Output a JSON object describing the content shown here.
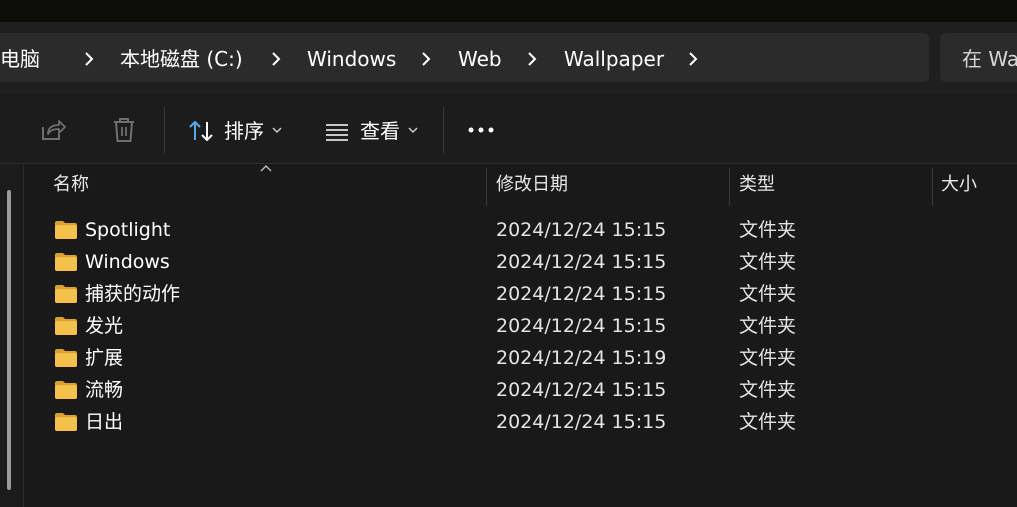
{
  "breadcrumb": {
    "items": [
      "此电脑",
      "本地磁盘 (C:)",
      "Windows",
      "Web",
      "Wallpaper"
    ]
  },
  "search": {
    "placeholder": "在 Wa"
  },
  "toolbar": {
    "share_icon": "share-icon",
    "delete_icon": "trash-icon",
    "sort_label": "排序",
    "view_label": "查看",
    "more_icon": "more-icon"
  },
  "columns": {
    "name": "名称",
    "modified": "修改日期",
    "type": "类型",
    "size": "大小"
  },
  "files": [
    {
      "name": "Spotlight",
      "modified": "2024/12/24 15:15",
      "type": "文件夹"
    },
    {
      "name": "Windows",
      "modified": "2024/12/24 15:15",
      "type": "文件夹"
    },
    {
      "name": "捕获的动作",
      "modified": "2024/12/24 15:15",
      "type": "文件夹"
    },
    {
      "name": "发光",
      "modified": "2024/12/24 15:15",
      "type": "文件夹"
    },
    {
      "name": "扩展",
      "modified": "2024/12/24 15:19",
      "type": "文件夹"
    },
    {
      "name": "流畅",
      "modified": "2024/12/24 15:15",
      "type": "文件夹"
    },
    {
      "name": "日出",
      "modified": "2024/12/24 15:15",
      "type": "文件夹"
    }
  ],
  "colors": {
    "folder": "#f4c24c",
    "folder_dark": "#d9a22c",
    "background": "#191919",
    "addressbar": "#2b2b2b"
  }
}
